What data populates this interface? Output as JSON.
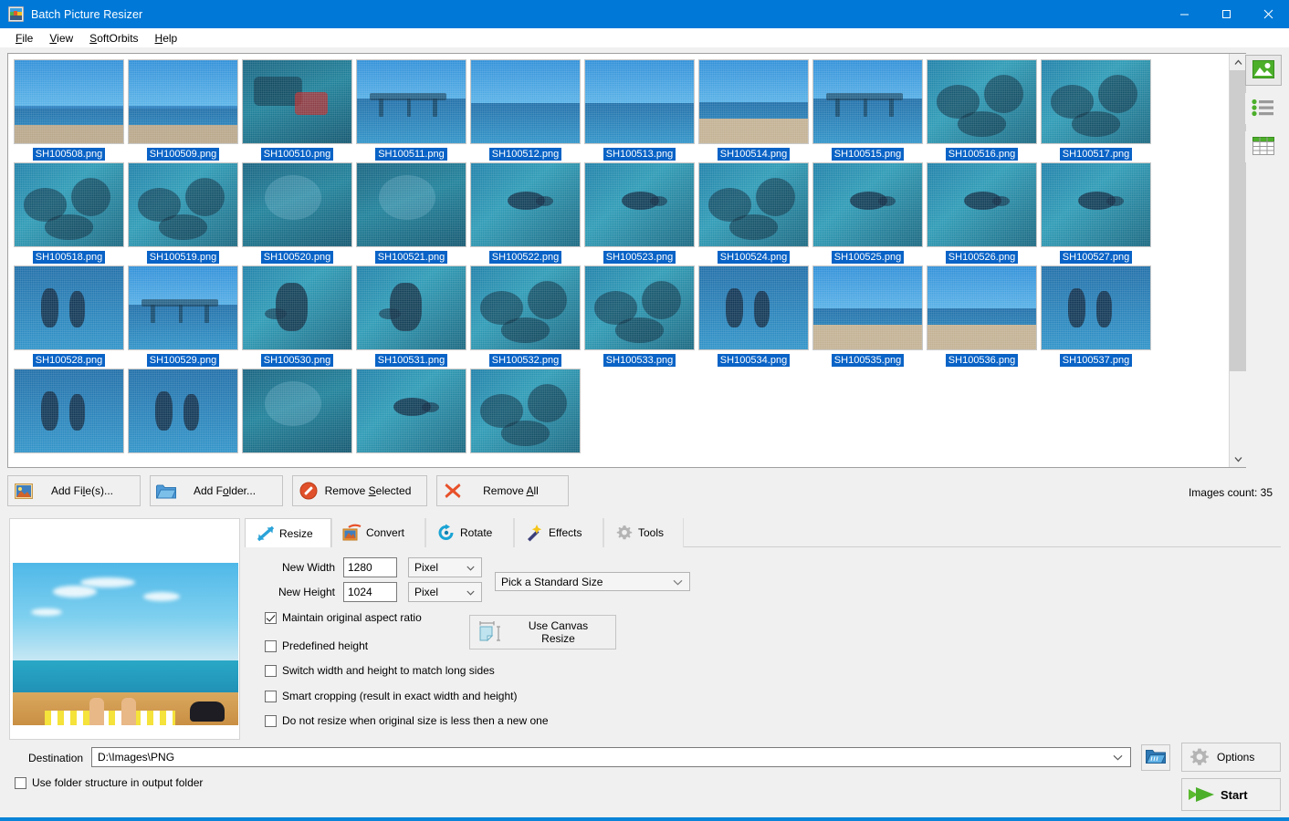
{
  "window": {
    "title": "Batch Picture Resizer",
    "icon": "app-icon",
    "controls": {
      "minimize": "─",
      "maximize": "□",
      "close": "✕"
    }
  },
  "menubar": {
    "items": [
      {
        "label": "File",
        "accel": "F"
      },
      {
        "label": "View",
        "accel": "V"
      },
      {
        "label": "SoftOrbits",
        "accel": "S"
      },
      {
        "label": "Help",
        "accel": "H"
      }
    ]
  },
  "thumbnails": {
    "items": [
      {
        "name": "SH100508.png",
        "style": "beach"
      },
      {
        "name": "SH100509.png",
        "style": "beach"
      },
      {
        "name": "SH100510.png",
        "style": "boat"
      },
      {
        "name": "SH100511.png",
        "style": "pier"
      },
      {
        "name": "SH100512.png",
        "style": "sea"
      },
      {
        "name": "SH100513.png",
        "style": "sea"
      },
      {
        "name": "SH100514.png",
        "style": "shore"
      },
      {
        "name": "SH100515.png",
        "style": "pier"
      },
      {
        "name": "SH100516.png",
        "style": "reef"
      },
      {
        "name": "SH100517.png",
        "style": "reef"
      },
      {
        "name": "SH100518.png",
        "style": "reef"
      },
      {
        "name": "SH100519.png",
        "style": "reef"
      },
      {
        "name": "SH100520.png",
        "style": "deep"
      },
      {
        "name": "SH100521.png",
        "style": "deep"
      },
      {
        "name": "SH100522.png",
        "style": "fish"
      },
      {
        "name": "SH100523.png",
        "style": "fish"
      },
      {
        "name": "SH100524.png",
        "style": "reef"
      },
      {
        "name": "SH100525.png",
        "style": "fish"
      },
      {
        "name": "SH100526.png",
        "style": "fish"
      },
      {
        "name": "SH100527.png",
        "style": "fish"
      },
      {
        "name": "SH100528.png",
        "style": "swim"
      },
      {
        "name": "SH100529.png",
        "style": "pier"
      },
      {
        "name": "SH100530.png",
        "style": "diver"
      },
      {
        "name": "SH100531.png",
        "style": "diver"
      },
      {
        "name": "SH100532.png",
        "style": "reef"
      },
      {
        "name": "SH100533.png",
        "style": "reef"
      },
      {
        "name": "SH100534.png",
        "style": "swim"
      },
      {
        "name": "SH100535.png",
        "style": "shore"
      },
      {
        "name": "SH100536.png",
        "style": "shore"
      },
      {
        "name": "SH100537.png",
        "style": "swim"
      },
      {
        "name": "",
        "style": "swim"
      },
      {
        "name": "",
        "style": "swim"
      },
      {
        "name": "",
        "style": "deep"
      },
      {
        "name": "",
        "style": "fish"
      },
      {
        "name": "",
        "style": "reef"
      }
    ]
  },
  "viewmodes": {
    "items": [
      {
        "name": "thumbnail-view",
        "icon": "picture-icon",
        "active": true
      },
      {
        "name": "list-view",
        "icon": "list-icon",
        "active": false
      },
      {
        "name": "details-view",
        "icon": "grid-icon",
        "active": false
      }
    ]
  },
  "filebar": {
    "add_files": {
      "label_before": "Add Fi",
      "accel": "l",
      "label_after": "e(s)...",
      "icon": "picture-add-icon"
    },
    "add_folder": {
      "label_before": "Add F",
      "accel": "o",
      "label_after": "lder...",
      "icon": "folder-icon"
    },
    "remove_selected": {
      "label_before": "Remove ",
      "accel": "S",
      "label_after": "elected",
      "icon": "forbidden-icon"
    },
    "remove_all": {
      "label_before": "Remove ",
      "accel": "A",
      "label_after": "ll",
      "icon": "cross-icon"
    },
    "images_count": "Images count: 35"
  },
  "tabs": [
    {
      "label": "Resize",
      "icon": "resize-arrow-icon",
      "active": true
    },
    {
      "label": "Convert",
      "icon": "convert-icon",
      "active": false
    },
    {
      "label": "Rotate",
      "icon": "rotate-icon",
      "active": false
    },
    {
      "label": "Effects",
      "icon": "magic-wand-icon",
      "active": false
    },
    {
      "label": "Tools",
      "icon": "gear-icon",
      "active": false
    }
  ],
  "resize": {
    "new_width": {
      "label": "New Width",
      "value": "1280",
      "unit": "Pixel"
    },
    "new_height": {
      "label": "New Height",
      "value": "1024",
      "unit": "Pixel"
    },
    "standard_size": {
      "value": "Pick a Standard Size"
    },
    "canvas_button": {
      "label": "Use Canvas Resize",
      "icon": "canvas-resize-icon"
    },
    "options": [
      {
        "label": "Maintain original aspect ratio",
        "checked": true
      },
      {
        "label": "Predefined height",
        "checked": false
      },
      {
        "label": "Switch width and height to match long sides",
        "checked": false
      },
      {
        "label": "Smart cropping (result in exact width and height)",
        "checked": false
      },
      {
        "label": "Do not resize when original size is less then a new one",
        "checked": false
      }
    ]
  },
  "bottom": {
    "destination_label": "Destination",
    "destination_value": "D:\\Images\\PNG",
    "browse": {
      "icon": "open-folder-icon"
    },
    "use_folder_structure": {
      "label": "Use folder structure in output folder",
      "checked": false
    },
    "options_button": {
      "label": "Options",
      "icon": "gear-icon"
    },
    "start_button": {
      "label": "Start",
      "icon": "green-arrow-icon"
    }
  },
  "colors": {
    "titlebar": "#0078d7",
    "accent": "#0a63c6",
    "panel": "#f0f0f0",
    "start_green": "#4caf2a"
  }
}
